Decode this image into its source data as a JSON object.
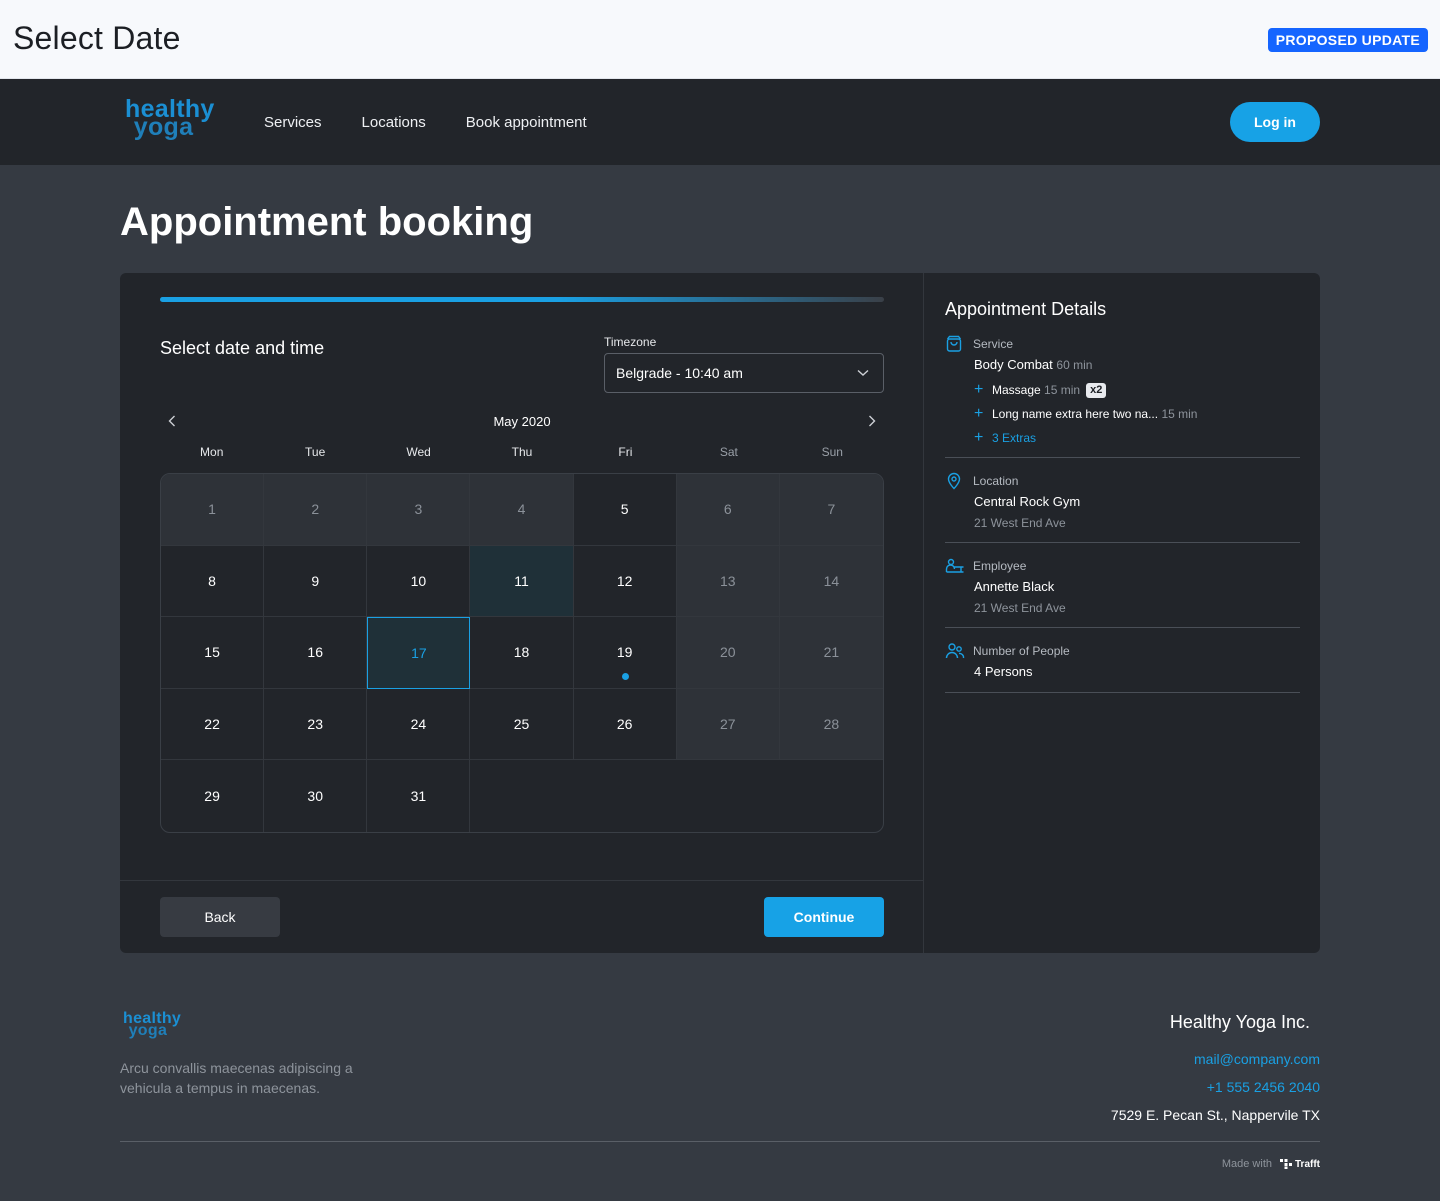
{
  "page": {
    "title": "Select Date",
    "badge": "PROPOSED UPDATE"
  },
  "nav": {
    "logo_line1": "healthy",
    "logo_line2": "yoga",
    "links": [
      "Services",
      "Locations",
      "Book appointment"
    ],
    "login": "Log in"
  },
  "heading": "Appointment booking",
  "booking": {
    "section_title": "Select date and time",
    "timezone_label": "Timezone",
    "timezone_value": "Belgrade - 10:40 am",
    "month": "May 2020",
    "weekdays": [
      "Mon",
      "Tue",
      "Wed",
      "Thu",
      "Fri",
      "Sat",
      "Sun"
    ],
    "days": [
      [
        "1",
        "2",
        "3",
        "4",
        "5",
        "6",
        "7"
      ],
      [
        "8",
        "9",
        "10",
        "11",
        "12",
        "13",
        "14"
      ],
      [
        "15",
        "16",
        "17",
        "18",
        "19",
        "20",
        "21"
      ],
      [
        "22",
        "23",
        "24",
        "25",
        "26",
        "27",
        "28"
      ],
      [
        "29",
        "30",
        "31",
        "",
        "",
        "",
        ""
      ]
    ],
    "selected_day": "17",
    "today": "11",
    "marked_day": "19",
    "back": "Back",
    "continue": "Continue"
  },
  "details": {
    "title": "Appointment Details",
    "service": {
      "label": "Service",
      "name": "Body Combat",
      "duration": "60 min",
      "extras": [
        {
          "name": "Massage",
          "duration": "15 min",
          "qty": "x2"
        },
        {
          "name": "Long name extra here two na...",
          "duration": "15 min"
        }
      ],
      "more_extras": "3 Extras"
    },
    "location": {
      "label": "Location",
      "name": "Central Rock Gym",
      "address": "21 West End Ave"
    },
    "employee": {
      "label": "Employee",
      "name": "Annette Black",
      "address": "21 West End Ave"
    },
    "people": {
      "label": "Number of People",
      "value": "4 Persons"
    }
  },
  "footer": {
    "logo_line1": "healthy",
    "logo_line2": "yoga",
    "tagline": "Arcu convallis maecenas adipiscing a vehicula a tempus in maecenas.",
    "company": "Healthy Yoga Inc.",
    "email": "mail@company.com",
    "phone": "+1 555 2456 2040",
    "address": "7529 E. Pecan St., Nappervile TX",
    "made_with": "Made with",
    "brand": "Trafft"
  },
  "colors": {
    "accent": "#17a2e6",
    "badge": "#1565ff",
    "card": "#22252a",
    "page": "#353a42"
  }
}
